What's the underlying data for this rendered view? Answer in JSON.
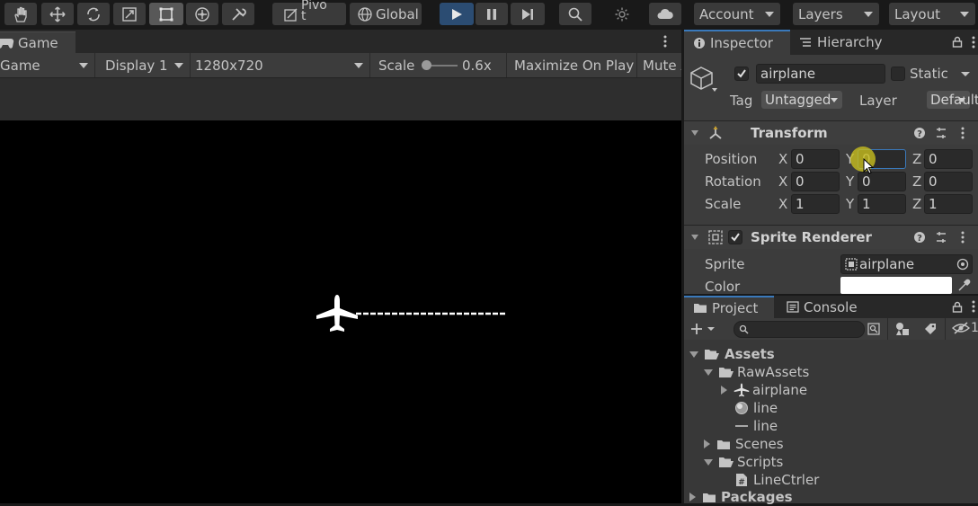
{
  "toolbar": {
    "pivot_label": "Pivo\nt",
    "global_label": "Global",
    "account_label": "Account",
    "layers_label": "Layers",
    "layout_label": "Layout",
    "play_color": "#2b4c72"
  },
  "game": {
    "tab_label": "Game",
    "view_dropdown": "Game",
    "display_dropdown": "Display 1",
    "resolution_dropdown": "1280x720",
    "scale_label": "Scale",
    "scale_value": "0.6x",
    "maximize_label": "Maximize On Play",
    "mute_label": "Mute A"
  },
  "inspector": {
    "tab_label": "Inspector",
    "hierarchy_tab_label": "Hierarchy",
    "object_name": "airplane",
    "static_label": "Static",
    "tag_label": "Tag",
    "tag_value": "Untagged",
    "layer_label": "Layer",
    "layer_value": "Default",
    "transform": {
      "title": "Transform",
      "position_label": "Position",
      "rotation_label": "Rotation",
      "scale_label": "Scale",
      "x_label": "X",
      "y_label": "Y",
      "z_label": "Z",
      "position": {
        "x": "0",
        "y": "0",
        "z": "0"
      },
      "rotation": {
        "x": "0",
        "y": "0",
        "z": "0"
      },
      "scale": {
        "x": "1",
        "y": "1",
        "z": "1"
      }
    },
    "sprite_renderer": {
      "title": "Sprite Renderer",
      "sprite_label": "Sprite",
      "sprite_value": "airplane",
      "color_label": "Color",
      "color_value": "#ffffff"
    }
  },
  "project": {
    "tab_label": "Project",
    "console_tab_label": "Console",
    "hidden_count": "1",
    "tree": {
      "assets": "Assets",
      "raw_assets": "RawAssets",
      "airplane": "airplane",
      "line_material": "line",
      "line_renderer": "line",
      "scenes": "Scenes",
      "scripts": "Scripts",
      "line_ctrler": "LineCtrler",
      "packages": "Packages"
    }
  }
}
